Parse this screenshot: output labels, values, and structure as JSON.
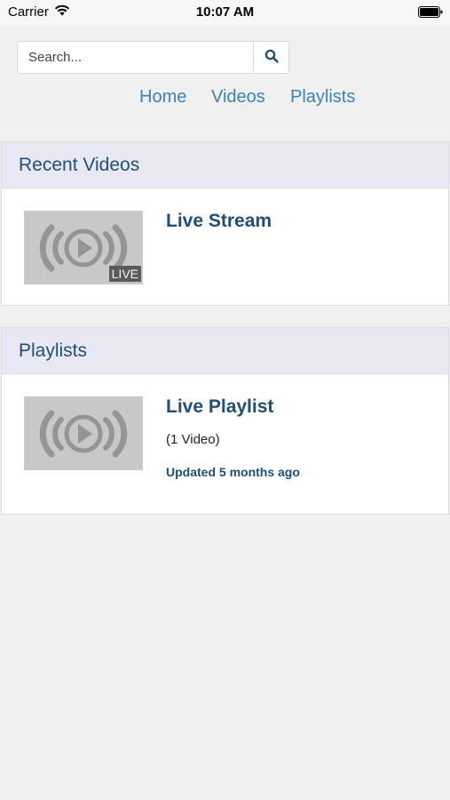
{
  "status": {
    "carrier": "Carrier",
    "time": "10:07 AM"
  },
  "search": {
    "placeholder": "Search..."
  },
  "nav": {
    "items": [
      "Home",
      "Videos",
      "Playlists"
    ]
  },
  "recent_videos": {
    "header": "Recent Videos",
    "items": [
      {
        "title": "Live Stream",
        "badge": "LIVE"
      }
    ]
  },
  "playlists": {
    "header": "Playlists",
    "items": [
      {
        "title": "Live Playlist",
        "count": "(1 Video)",
        "updated": "Updated 5 months ago"
      }
    ]
  },
  "colors": {
    "link": "#3a82b9",
    "heading": "#1f4f76",
    "panel_header_bg": "#e8e8f2"
  }
}
